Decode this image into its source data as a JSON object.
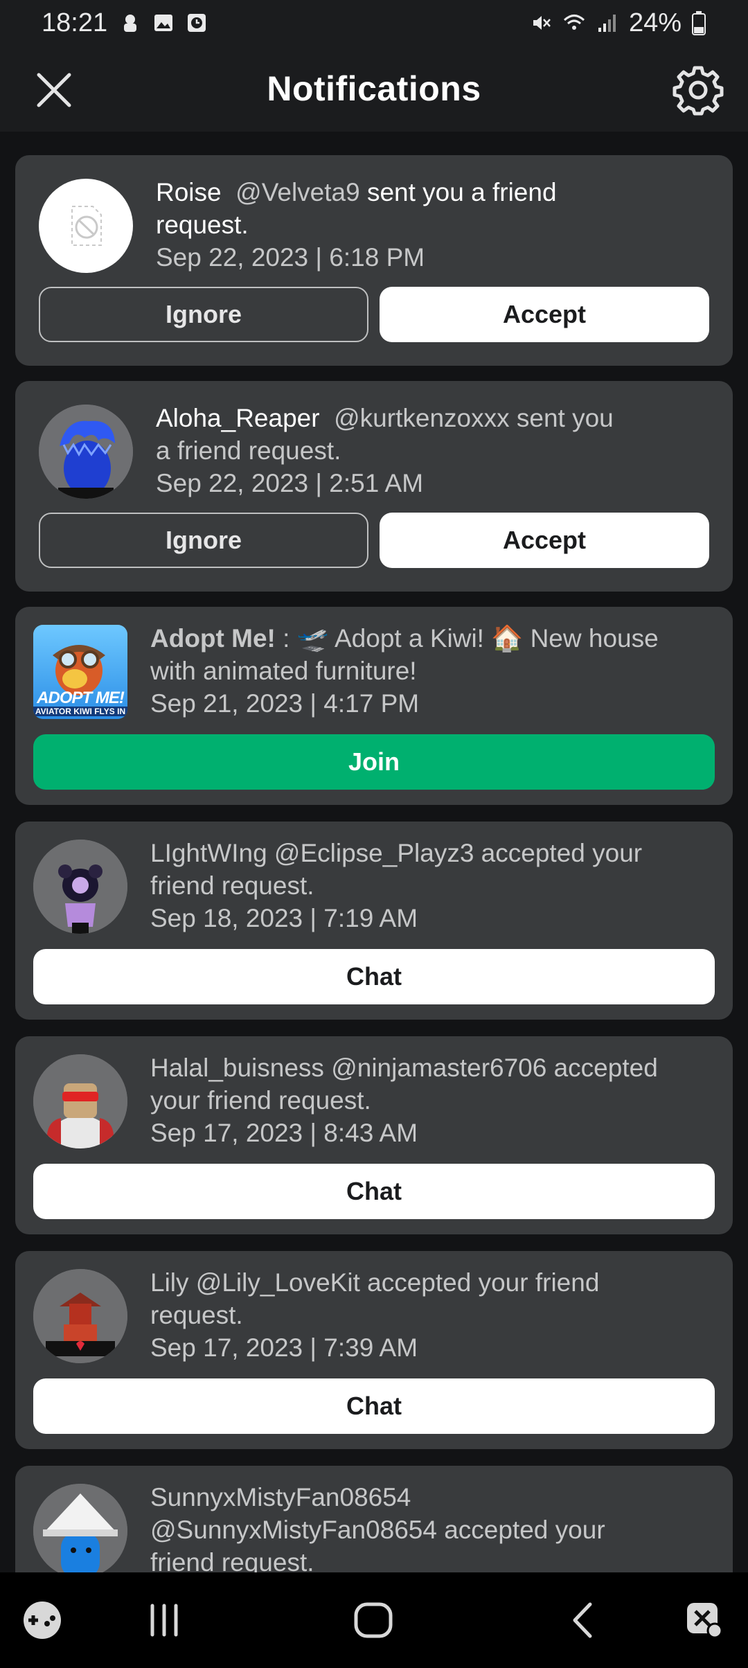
{
  "status_bar": {
    "time": "18:21",
    "battery": "24%",
    "icons": [
      "notification-icon",
      "image-icon",
      "clock-icon",
      "mute-icon",
      "wifi-icon",
      "signal-icon",
      "battery-icon"
    ]
  },
  "header": {
    "title": "Notifications",
    "close_icon": "close-icon",
    "settings_icon": "gear-icon"
  },
  "notifications": [
    {
      "display_name": "Roise",
      "username": "@Velveta9",
      "message_line1": " sent you a friend",
      "message_line2": "request.",
      "date": "Sep 22, 2023 | 6:18 PM",
      "ignore_label": "Ignore",
      "accept_label": "Accept"
    },
    {
      "display_name": "Aloha_Reaper",
      "username": "@kurtkenzoxxx",
      "message_line1": " sent you",
      "message_line2": "a friend request.",
      "date": "Sep 22, 2023 | 2:51 AM",
      "ignore_label": "Ignore",
      "accept_label": "Accept"
    },
    {
      "game_name": "Adopt Me!",
      "message_line1": " : 🛫 Adopt a Kiwi! 🏠 New house",
      "message_line2": "with animated furniture!",
      "date": "Sep 21, 2023 | 4:17 PM",
      "join_label": "Join",
      "thumb_text": "ADOPT ME!",
      "thumb_sub": "AVIATOR KIWI FLYS IN"
    },
    {
      "line1": "LIghtWIng @Eclipse_Playz3 accepted your",
      "line2": "friend request.",
      "date": "Sep 18, 2023 | 7:19 AM",
      "chat_label": "Chat"
    },
    {
      "line1": "Halal_buisness @ninjamaster6706 accepted",
      "line2": "your friend request.",
      "date": "Sep 17, 2023 | 8:43 AM",
      "chat_label": "Chat"
    },
    {
      "line1": "Lily @Lily_LoveKit accepted your friend",
      "line2": "request.",
      "date": "Sep 17, 2023 | 7:39 AM",
      "chat_label": "Chat"
    },
    {
      "line1": "SunnyxMistyFan08654",
      "line2": "@SunnyxMistyFan08654 accepted your",
      "line3": "friend request."
    }
  ],
  "nav_bar": {
    "icons": [
      "game-controller-icon",
      "recent-apps-icon",
      "home-icon",
      "back-icon",
      "assistant-icon"
    ]
  }
}
